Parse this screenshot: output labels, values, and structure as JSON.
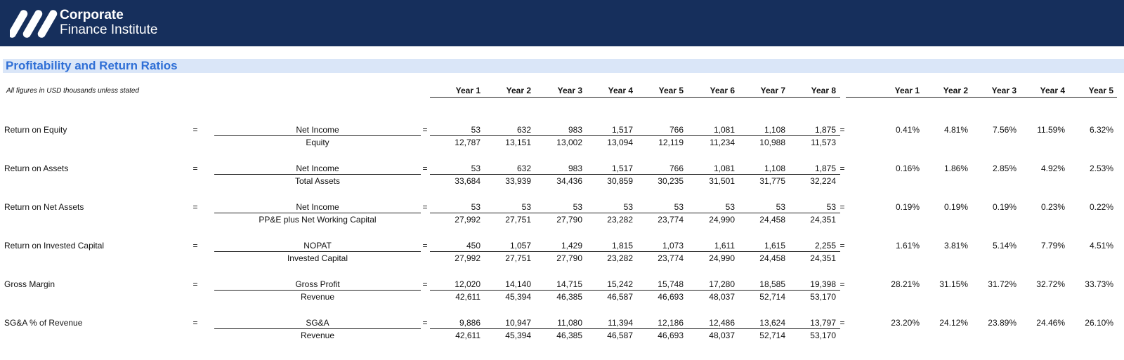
{
  "brand": {
    "line1": "Corporate",
    "line2": "Finance Institute",
    "color": "#162f5c"
  },
  "section": {
    "title": "Profitability and Return Ratios"
  },
  "note": "All figures in USD thousands unless stated",
  "year_headers": [
    "Year 1",
    "Year 2",
    "Year 3",
    "Year 4",
    "Year 5",
    "Year 6",
    "Year 7",
    "Year 8"
  ],
  "ratio_headers": [
    "Year 1",
    "Year 2",
    "Year 3",
    "Year 4",
    "Year 5"
  ],
  "symbols": {
    "eq": "="
  },
  "rows": [
    {
      "label": "Return on Equity",
      "numerator": "Net Income",
      "denominator": "Equity",
      "num_values": [
        "53",
        "632",
        "983",
        "1,517",
        "766",
        "1,081",
        "1,108",
        "1,875"
      ],
      "den_values": [
        "12,787",
        "13,151",
        "13,002",
        "13,094",
        "12,119",
        "11,234",
        "10,988",
        "11,573"
      ],
      "ratios": [
        "0.41%",
        "4.81%",
        "7.56%",
        "11.59%",
        "6.32%"
      ]
    },
    {
      "label": "Return on Assets",
      "numerator": "Net Income",
      "denominator": "Total Assets",
      "num_values": [
        "53",
        "632",
        "983",
        "1,517",
        "766",
        "1,081",
        "1,108",
        "1,875"
      ],
      "den_values": [
        "33,684",
        "33,939",
        "34,436",
        "30,859",
        "30,235",
        "31,501",
        "31,775",
        "32,224"
      ],
      "ratios": [
        "0.16%",
        "1.86%",
        "2.85%",
        "4.92%",
        "2.53%"
      ]
    },
    {
      "label": "Return on Net Assets",
      "numerator": "Net Income",
      "denominator": "PP&E plus Net Working Capital",
      "num_values": [
        "53",
        "53",
        "53",
        "53",
        "53",
        "53",
        "53",
        "53"
      ],
      "den_values": [
        "27,992",
        "27,751",
        "27,790",
        "23,282",
        "23,774",
        "24,990",
        "24,458",
        "24,351"
      ],
      "ratios": [
        "0.19%",
        "0.19%",
        "0.19%",
        "0.23%",
        "0.22%"
      ]
    },
    {
      "label": "Return on Invested Capital",
      "numerator": "NOPAT",
      "denominator": "Invested Capital",
      "num_values": [
        "450",
        "1,057",
        "1,429",
        "1,815",
        "1,073",
        "1,611",
        "1,615",
        "2,255"
      ],
      "den_values": [
        "27,992",
        "27,751",
        "27,790",
        "23,282",
        "23,774",
        "24,990",
        "24,458",
        "24,351"
      ],
      "ratios": [
        "1.61%",
        "3.81%",
        "5.14%",
        "7.79%",
        "4.51%"
      ]
    },
    {
      "label": "Gross Margin",
      "numerator": "Gross Profit",
      "denominator": "Revenue",
      "num_values": [
        "12,020",
        "14,140",
        "14,715",
        "15,242",
        "15,748",
        "17,280",
        "18,585",
        "19,398"
      ],
      "den_values": [
        "42,611",
        "45,394",
        "46,385",
        "46,587",
        "46,693",
        "48,037",
        "52,714",
        "53,170"
      ],
      "ratios": [
        "28.21%",
        "31.15%",
        "31.72%",
        "32.72%",
        "33.73%"
      ]
    },
    {
      "label": "SG&A % of Revenue",
      "numerator": "SG&A",
      "denominator": "Revenue",
      "num_values": [
        "9,886",
        "10,947",
        "11,080",
        "11,394",
        "12,186",
        "12,486",
        "13,624",
        "13,797"
      ],
      "den_values": [
        "42,611",
        "45,394",
        "46,385",
        "46,587",
        "46,693",
        "48,037",
        "52,714",
        "53,170"
      ],
      "ratios": [
        "23.20%",
        "24.12%",
        "23.89%",
        "24.46%",
        "26.10%"
      ]
    }
  ]
}
